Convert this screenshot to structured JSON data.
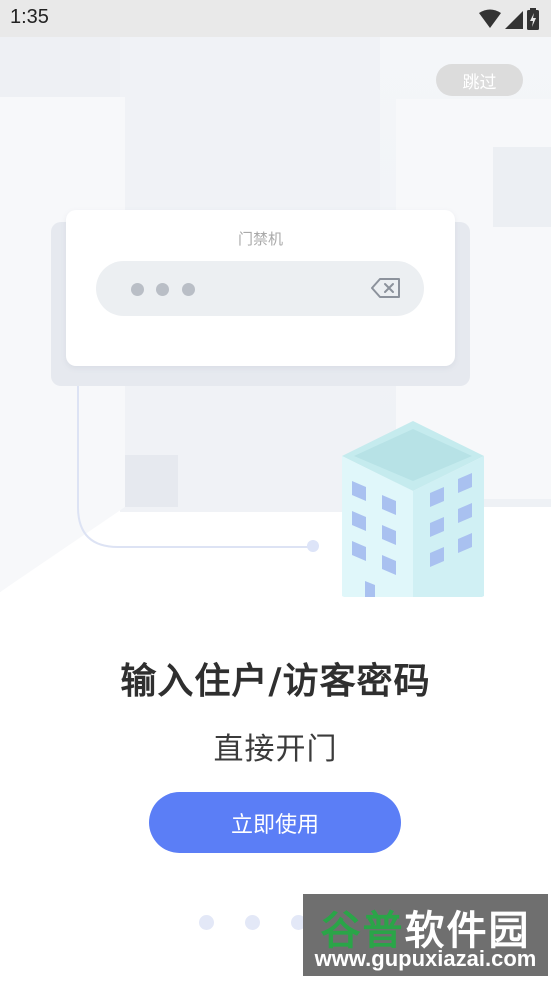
{
  "status_bar": {
    "time": "1:35",
    "icons": [
      "wifi-icon",
      "signal-icon",
      "battery-charging-icon"
    ]
  },
  "skip_label": "跳过",
  "door_panel": {
    "title": "门禁机",
    "password_dots": 3,
    "icon": "backspace-icon"
  },
  "headline": "输入住户/访客密码",
  "subline": "直接开门",
  "cta_label": "立即使用",
  "pager": {
    "total": 3,
    "active_index": 2
  },
  "watermark": {
    "brand_a": "谷普",
    "brand_b": "软件园",
    "url": "www.gupuxiazai.com"
  },
  "colors": {
    "accent": "#5b7ef6",
    "page_dot": "#e3e8f7",
    "status_bar": "#e9e9e9"
  }
}
